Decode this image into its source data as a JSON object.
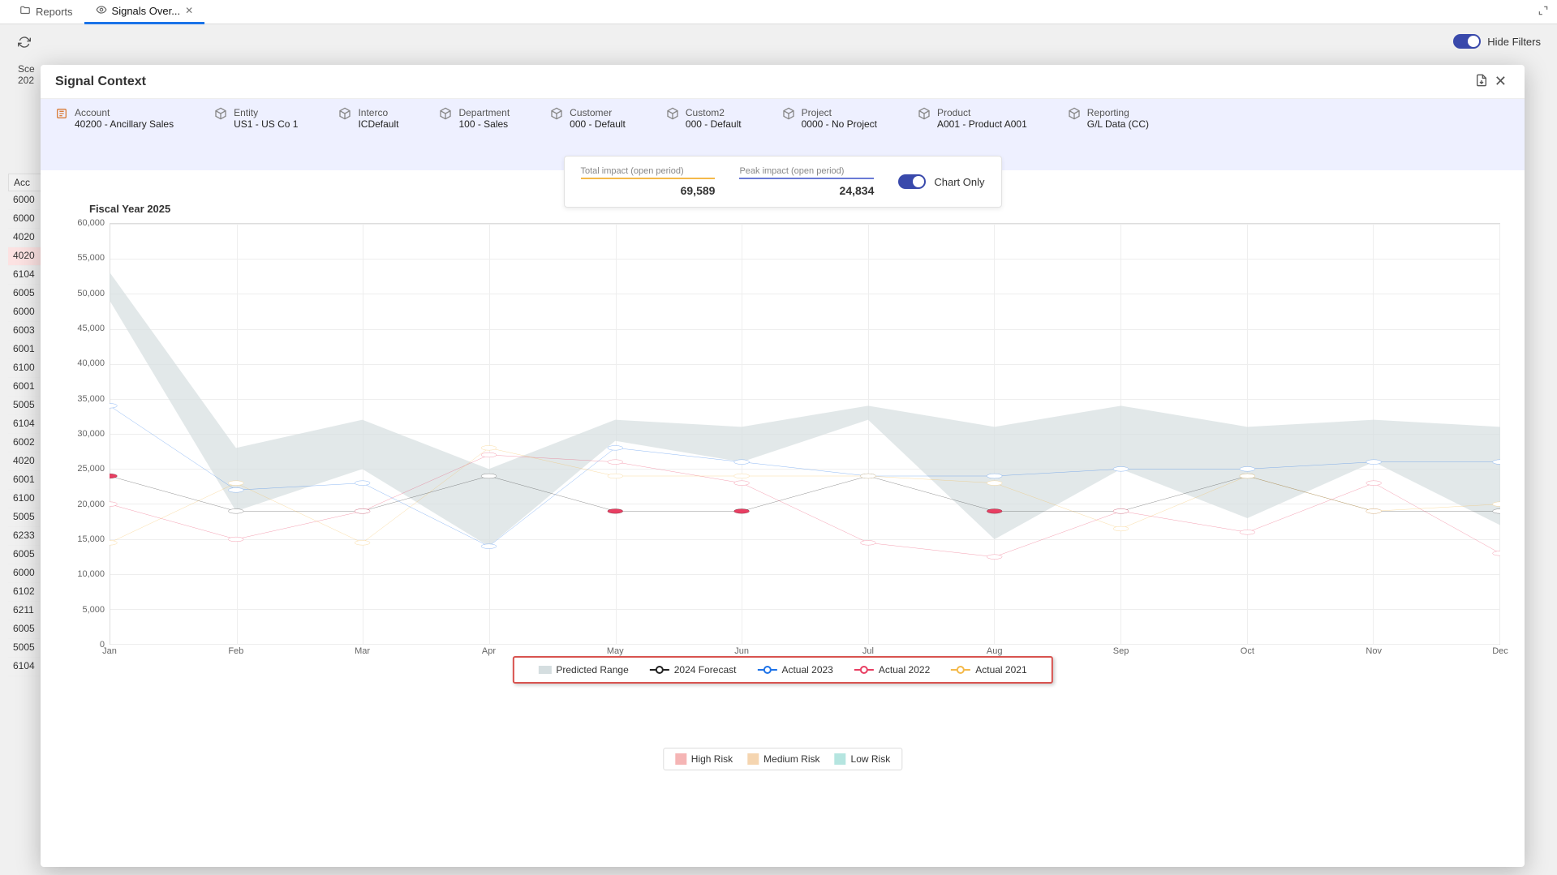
{
  "tabs": {
    "reports": "Reports",
    "signals": "Signals Over..."
  },
  "hide_filters": "Hide Filters",
  "bg": {
    "scen_label": "Sce",
    "scen_val": "202",
    "acc_hdr": "Acc",
    "rows": [
      "6000",
      "6000",
      "4020",
      "4020",
      "6104",
      "6005",
      "6000",
      "6003",
      "6001",
      "6100",
      "6001",
      "5005",
      "6104",
      "6002",
      "4020",
      "6001",
      "6100",
      "5005",
      "6233",
      "6005",
      "6000",
      "6102",
      "6211",
      "6005",
      "5005",
      "6104"
    ]
  },
  "modal": {
    "title": "Signal Context",
    "dims": [
      {
        "label": "Account",
        "value": "40200 - Ancillary Sales",
        "icon": "account"
      },
      {
        "label": "Entity",
        "value": "US1 - US Co 1"
      },
      {
        "label": "Interco",
        "value": "ICDefault"
      },
      {
        "label": "Department",
        "value": "100 - Sales"
      },
      {
        "label": "Customer",
        "value": "000 - Default"
      },
      {
        "label": "Custom2",
        "value": "000 - Default"
      },
      {
        "label": "Project",
        "value": "0000 - No Project"
      },
      {
        "label": "Product",
        "value": "A001 - Product A001"
      },
      {
        "label": "Reporting",
        "value": "G/L Data (CC)"
      }
    ],
    "kpi1_label": "Total impact (open period)",
    "kpi1_value": "69,589",
    "kpi2_label": "Peak impact (open period)",
    "kpi2_value": "24,834",
    "chart_only": "Chart Only"
  },
  "chart_data": {
    "type": "line",
    "title": "Fiscal Year 2025",
    "xlabel": "",
    "ylabel": "",
    "ylim": [
      0,
      60000
    ],
    "yticks": [
      0,
      5000,
      10000,
      15000,
      20000,
      25000,
      30000,
      35000,
      40000,
      45000,
      50000,
      55000,
      60000
    ],
    "ytick_labels": [
      "0",
      "5,000",
      "10,000",
      "15,000",
      "20,000",
      "25,000",
      "30,000",
      "35,000",
      "40,000",
      "45,000",
      "50,000",
      "55,000",
      "60,000"
    ],
    "categories": [
      "Jan",
      "Feb",
      "Mar",
      "Apr",
      "May",
      "Jun",
      "Jul",
      "Aug",
      "Sep",
      "Oct",
      "Nov",
      "Dec"
    ],
    "predicted_range": {
      "upper": [
        53000,
        28000,
        32000,
        25000,
        32000,
        31000,
        34000,
        31000,
        34000,
        31000,
        32000,
        31000
      ],
      "lower": [
        49000,
        19000,
        25000,
        14000,
        29000,
        26000,
        32000,
        15000,
        25000,
        18000,
        26000,
        17000
      ]
    },
    "series": [
      {
        "name": "2024 Forecast",
        "color": "#222222",
        "values": [
          24000,
          19000,
          19000,
          24000,
          19000,
          19000,
          24000,
          19000,
          19000,
          24000,
          19000,
          19000
        ],
        "high_risk_idx": [
          0,
          2,
          4,
          5,
          7,
          8,
          10
        ]
      },
      {
        "name": "Actual 2023",
        "color": "#1e73e8",
        "values": [
          34000,
          22000,
          23000,
          14000,
          28000,
          26000,
          24000,
          24000,
          25000,
          25000,
          26000,
          26000
        ]
      },
      {
        "name": "Actual 2022",
        "color": "#e83e62",
        "values": [
          20000,
          15000,
          19000,
          27000,
          26000,
          23000,
          14500,
          12500,
          19000,
          16000,
          23000,
          13000
        ]
      },
      {
        "name": "Actual 2021",
        "color": "#f4b94a",
        "values": [
          14500,
          23000,
          14500,
          28000,
          24000,
          24000,
          24000,
          23000,
          16500,
          24000,
          19000,
          20000
        ]
      }
    ],
    "legend": [
      "Predicted Range",
      "2024 Forecast",
      "Actual 2023",
      "Actual 2022",
      "Actual 2021"
    ],
    "risk_legend": [
      "High Risk",
      "Medium Risk",
      "Low Risk"
    ],
    "risk_colors": [
      "#f5b5b5",
      "#f5d5b0",
      "#b5e5e0"
    ]
  }
}
